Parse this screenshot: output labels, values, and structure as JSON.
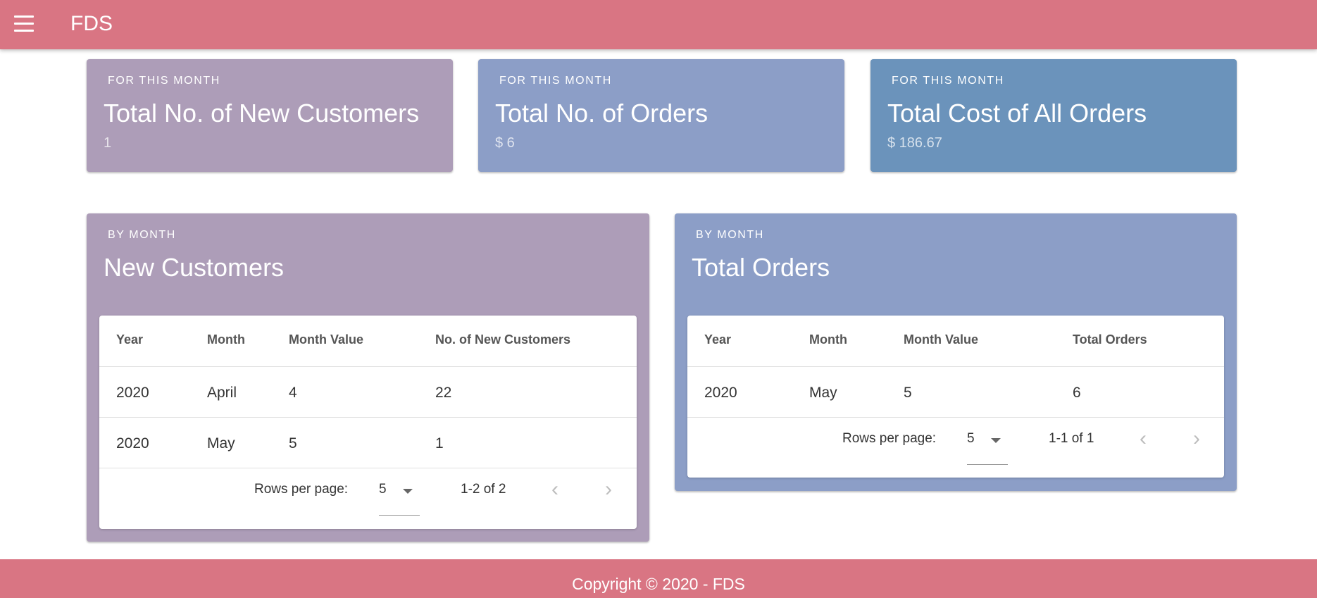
{
  "appbar": {
    "title": "FDS",
    "menu_icon": "hamburger-menu-icon",
    "color": "#d97583"
  },
  "summary_cards": [
    {
      "overline": "FOR THIS MONTH",
      "title": "Total No. of New Customers",
      "value": "1",
      "color": "#ad9db8"
    },
    {
      "overline": "FOR THIS MONTH",
      "title": "Total No. of Orders",
      "value": "$ 6",
      "color": "#8c9ec7"
    },
    {
      "overline": "FOR THIS MONTH",
      "title": "Total Cost of All Orders",
      "value": "$ 186.67",
      "color": "#6b93bb"
    }
  ],
  "new_customers": {
    "overline": "BY MONTH",
    "title": "New Customers",
    "color": "#ad9db8",
    "columns": [
      "Year",
      "Month",
      "Month Value",
      "No. of New Customers"
    ],
    "rows": [
      [
        "2020",
        "April",
        "4",
        "22"
      ],
      [
        "2020",
        "May",
        "5",
        "1"
      ]
    ],
    "pagination": {
      "rows_per_page_label": "Rows per page:",
      "rows_per_page": "5",
      "range": "1-2 of 2"
    }
  },
  "total_orders": {
    "overline": "BY MONTH",
    "title": "Total Orders",
    "color": "#8c9ec7",
    "columns": [
      "Year",
      "Month",
      "Month Value",
      "Total Orders"
    ],
    "rows": [
      [
        "2020",
        "May",
        "5",
        "6"
      ]
    ],
    "pagination": {
      "rows_per_page_label": "Rows per page:",
      "rows_per_page": "5",
      "range": "1-1 of 1"
    }
  },
  "footer": {
    "text": "Copyright © 2020 - FDS",
    "color": "#d97583"
  }
}
